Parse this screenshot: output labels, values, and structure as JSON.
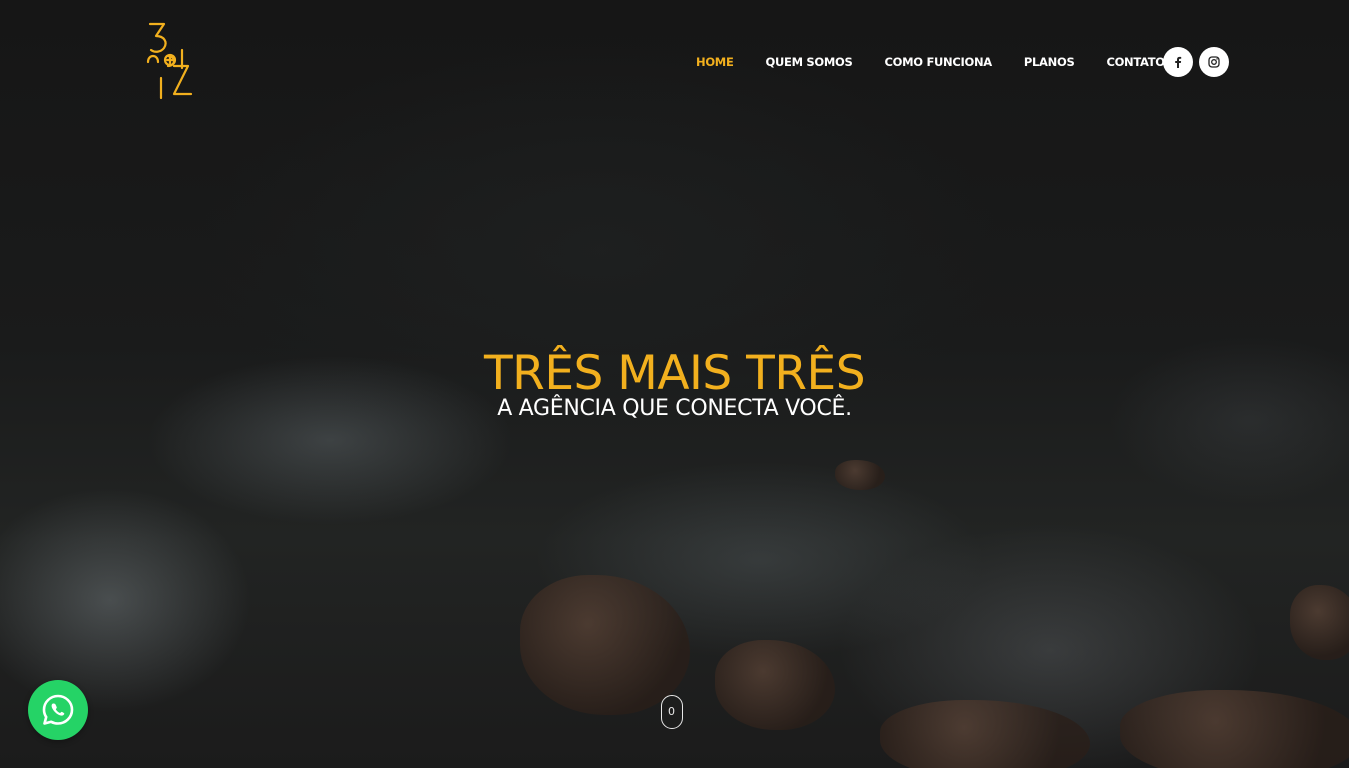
{
  "brand": {
    "logo_icon": "tres-mais-tres-logo",
    "accent_color": "#f2b01e"
  },
  "nav": {
    "items": [
      {
        "label": "HOME",
        "active": true
      },
      {
        "label": "QUEM SOMOS",
        "active": false
      },
      {
        "label": "COMO FUNCIONA",
        "active": false
      },
      {
        "label": "PLANOS",
        "active": false
      },
      {
        "label": "CONTATO",
        "active": false
      }
    ],
    "social": [
      {
        "icon": "facebook-icon"
      },
      {
        "icon": "instagram-icon"
      }
    ]
  },
  "hero": {
    "title": "TRÊS MAIS TRÊS",
    "subtitle": "A AGÊNCIA QUE CONECTA VOCÊ.",
    "scroll_label": "0"
  },
  "floating": {
    "whatsapp_icon": "whatsapp-icon",
    "whatsapp_color": "#25d366"
  }
}
